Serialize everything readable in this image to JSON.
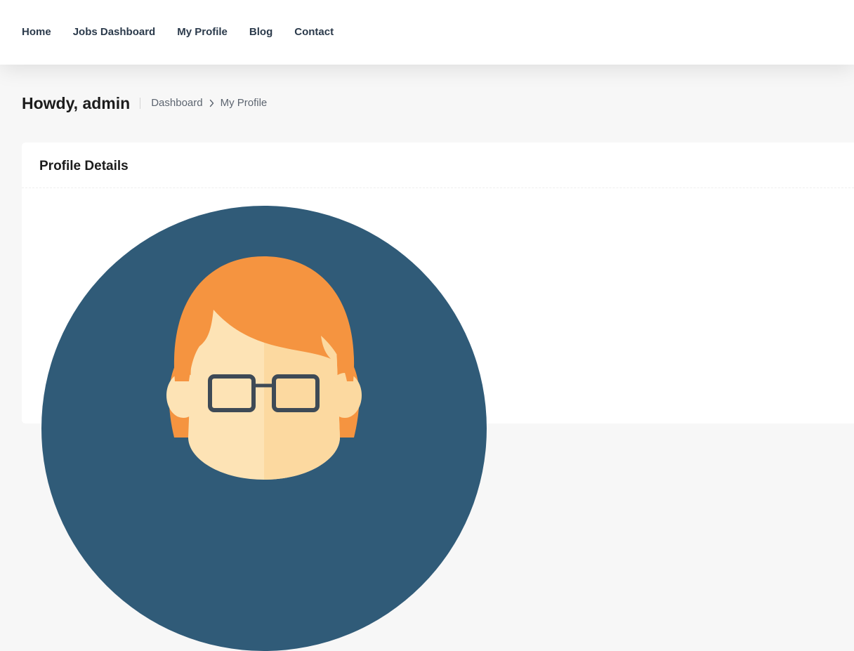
{
  "nav": {
    "items": [
      {
        "label": "Home"
      },
      {
        "label": "Jobs Dashboard"
      },
      {
        "label": "My Profile"
      },
      {
        "label": "Blog"
      },
      {
        "label": "Contact"
      }
    ]
  },
  "header": {
    "greeting": "Howdy, admin",
    "breadcrumb": {
      "home": "Dashboard",
      "current": "My Profile"
    }
  },
  "profile_card": {
    "title": "Profile Details"
  },
  "colors": {
    "avatar_bg": "#305b78",
    "hair": "#f59440",
    "skin": "#fde3b5",
    "skin_shade": "#fcd9a0",
    "glasses": "#3e4a56"
  },
  "icons": {
    "breadcrumb_separator": "chevron-right-icon",
    "avatar": "user-avatar-illustration"
  }
}
